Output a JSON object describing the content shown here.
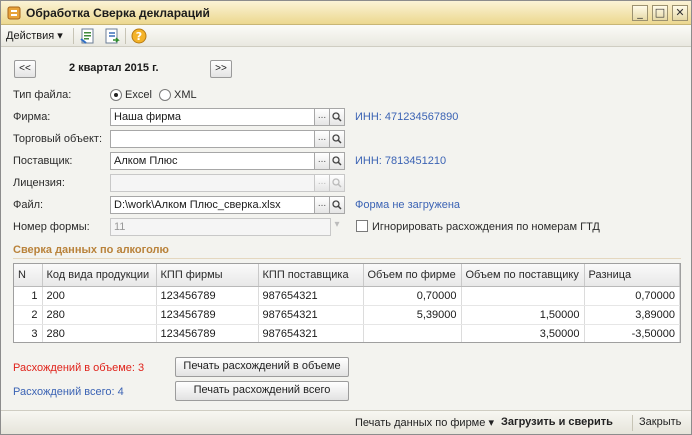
{
  "window": {
    "title": "Обработка  Сверка деклараций",
    "controls": {
      "minimize": "_",
      "maximize": "□",
      "close": "✕"
    }
  },
  "toolbar": {
    "actions_label": "Действия",
    "actions_arrow": "▾",
    "help_symbol": "?"
  },
  "period": {
    "prev": "<<",
    "label": "2 квартал 2015 г.",
    "next": ">>"
  },
  "form": {
    "file_type_label": "Тип файла:",
    "file_type_options": [
      {
        "label": "Excel",
        "selected": true
      },
      {
        "label": "XML",
        "selected": false
      }
    ],
    "firm_label": "Фирма:",
    "firm_value": "Наша фирма",
    "firm_inn": "ИНН: 471234567890",
    "trade_object_label": "Торговый объект:",
    "trade_object_value": "",
    "supplier_label": "Поставщик:",
    "supplier_value": "Алком Плюс",
    "supplier_inn": "ИНН: 7813451210",
    "license_label": "Лицензия:",
    "license_value": "",
    "file_label": "Файл:",
    "file_value": "D:\\work\\Алком Плюс_сверка.xlsx",
    "file_status": "Форма не загружена",
    "form_number_label": "Номер формы:",
    "form_number_value": "11",
    "ignore_gtd_label": "Игнорировать расхождения по номерам ГТД",
    "select_symbol": "...",
    "search_symbol": "🔍"
  },
  "section": {
    "title": "Сверка данных по алкоголю"
  },
  "table": {
    "columns": [
      "N",
      "Код вида продукции",
      "КПП фирмы",
      "КПП поставщика",
      "Объем по фирме",
      "Объем по поставщику",
      "Разница"
    ],
    "rows": [
      {
        "n": "1",
        "code": "200",
        "kpp_firm": "123456789",
        "kpp_supplier": "987654321",
        "vol_firm": "0,70000",
        "vol_supplier": "",
        "diff": "0,70000"
      },
      {
        "n": "2",
        "code": "280",
        "kpp_firm": "123456789",
        "kpp_supplier": "987654321",
        "vol_firm": "5,39000",
        "vol_supplier": "1,50000",
        "diff": "3,89000"
      },
      {
        "n": "3",
        "code": "280",
        "kpp_firm": "123456789",
        "kpp_supplier": "987654321",
        "vol_firm": "",
        "vol_supplier": "3,50000",
        "diff": "-3,50000"
      }
    ]
  },
  "summary": {
    "volume_diff": "Расхождений в объеме: 3",
    "total_diff": "Расхождений всего: 4",
    "print_volume_button": "Печать расхождений в объеме",
    "print_total_button": "Печать расхождений всего"
  },
  "bottom": {
    "print_firm_data": "Печать данных по фирме",
    "print_firm_arrow": "▾",
    "load_and_compare": "Загрузить и сверить",
    "close": "Закрыть"
  },
  "colors": {
    "accent_blue": "#3b63b4",
    "alert_red": "#e0231b",
    "section_orange": "#b9823a",
    "titlebar": "#ecd88f"
  }
}
